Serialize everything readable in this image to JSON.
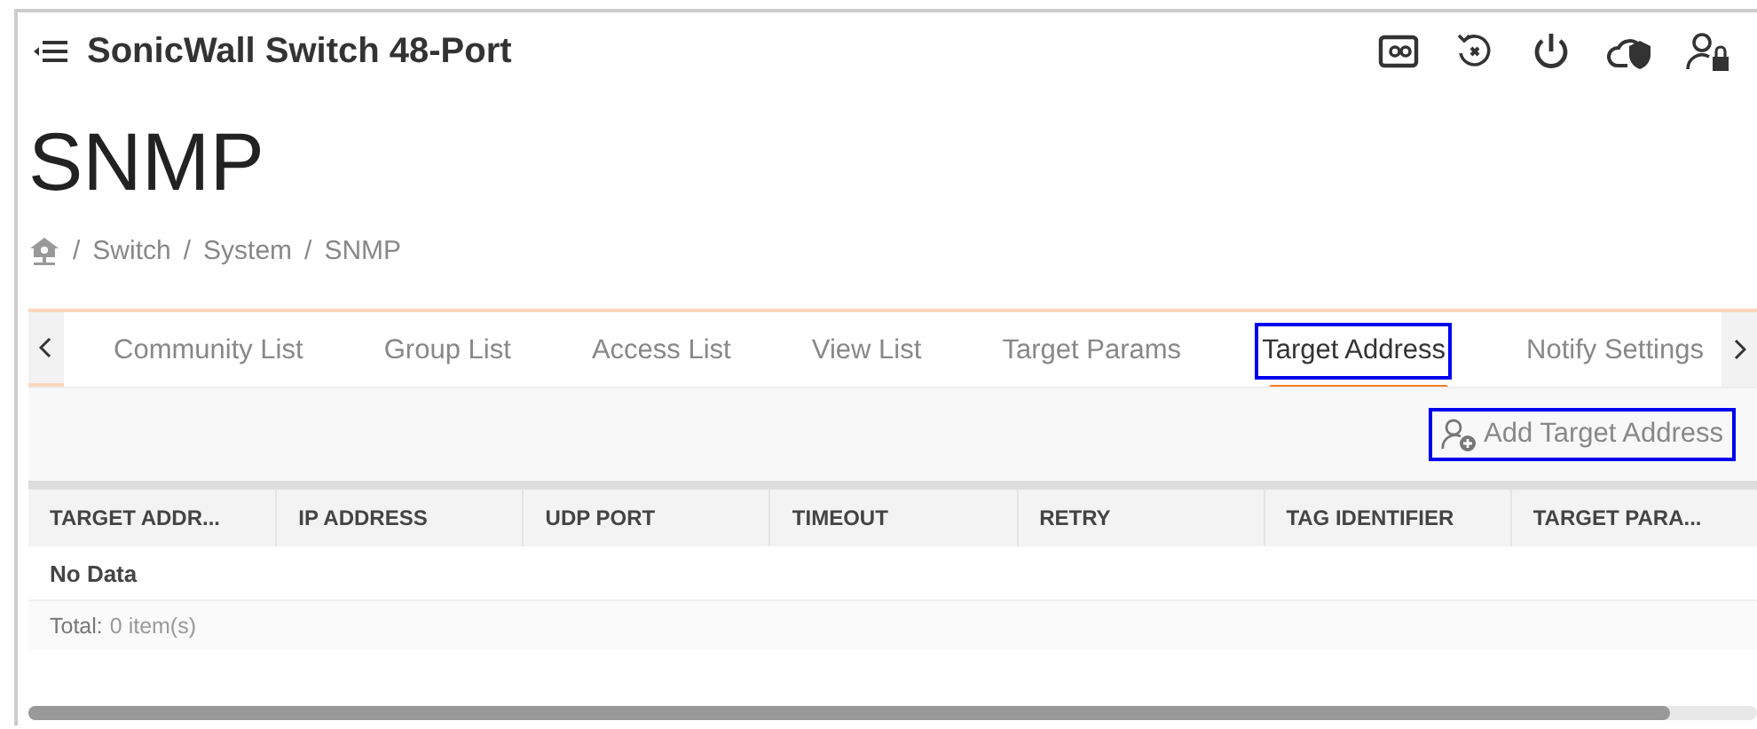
{
  "header": {
    "title": "SonicWall Switch 48-Port"
  },
  "page_title": "SNMP",
  "breadcrumb": [
    {
      "separator": "/",
      "label": "Switch"
    },
    {
      "separator": "/",
      "label": "System"
    },
    {
      "separator": "/",
      "label": "SNMP"
    }
  ],
  "tabs": [
    {
      "label": "Community List",
      "selected": false,
      "highlighted": false
    },
    {
      "label": "Group List",
      "selected": false,
      "highlighted": false
    },
    {
      "label": "Access List",
      "selected": false,
      "highlighted": false
    },
    {
      "label": "View List",
      "selected": false,
      "highlighted": false
    },
    {
      "label": "Target Params",
      "selected": false,
      "highlighted": false
    },
    {
      "label": "Target Address",
      "selected": true,
      "highlighted": true
    },
    {
      "label": "Notify Settings",
      "selected": false,
      "highlighted": false
    }
  ],
  "add_button": {
    "label": "Add Target Address",
    "highlighted": true
  },
  "table": {
    "columns": [
      "TARGET ADDR...",
      "IP ADDRESS",
      "UDP PORT",
      "TIMEOUT",
      "RETRY",
      "TAG IDENTIFIER",
      "TARGET PARA..."
    ],
    "empty_text": "No Data",
    "total_label": "Total:",
    "total_value": "0 item(s)"
  }
}
